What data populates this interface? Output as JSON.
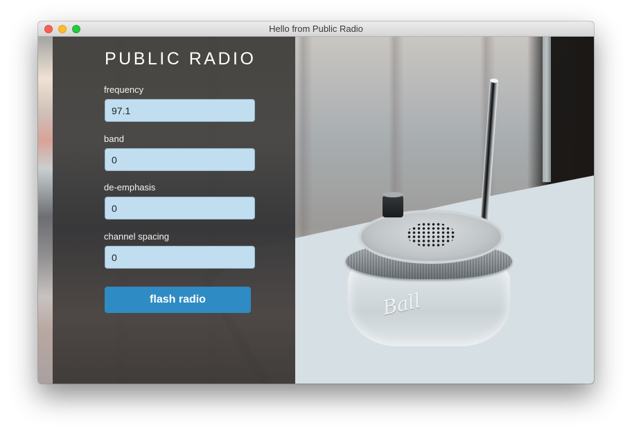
{
  "window": {
    "title": "Hello from Public Radio",
    "controls": [
      "close",
      "minimize",
      "maximize"
    ]
  },
  "app": {
    "title": "PUBLIC RADIO"
  },
  "form": {
    "fields": [
      {
        "label": "frequency",
        "value": "97.1"
      },
      {
        "label": "band",
        "value": "0"
      },
      {
        "label": "de-emphasis",
        "value": "0"
      },
      {
        "label": "channel spacing",
        "value": "0"
      }
    ],
    "submit_label": "flash radio"
  },
  "photo": {
    "jar_brand": "Ball",
    "description": "mason jar radio with antenna on a window sill"
  },
  "colors": {
    "button": "#2e8bc4",
    "input_background": "#c0def0",
    "panel_overlay": "#444240",
    "title_text": "#ffffff"
  }
}
